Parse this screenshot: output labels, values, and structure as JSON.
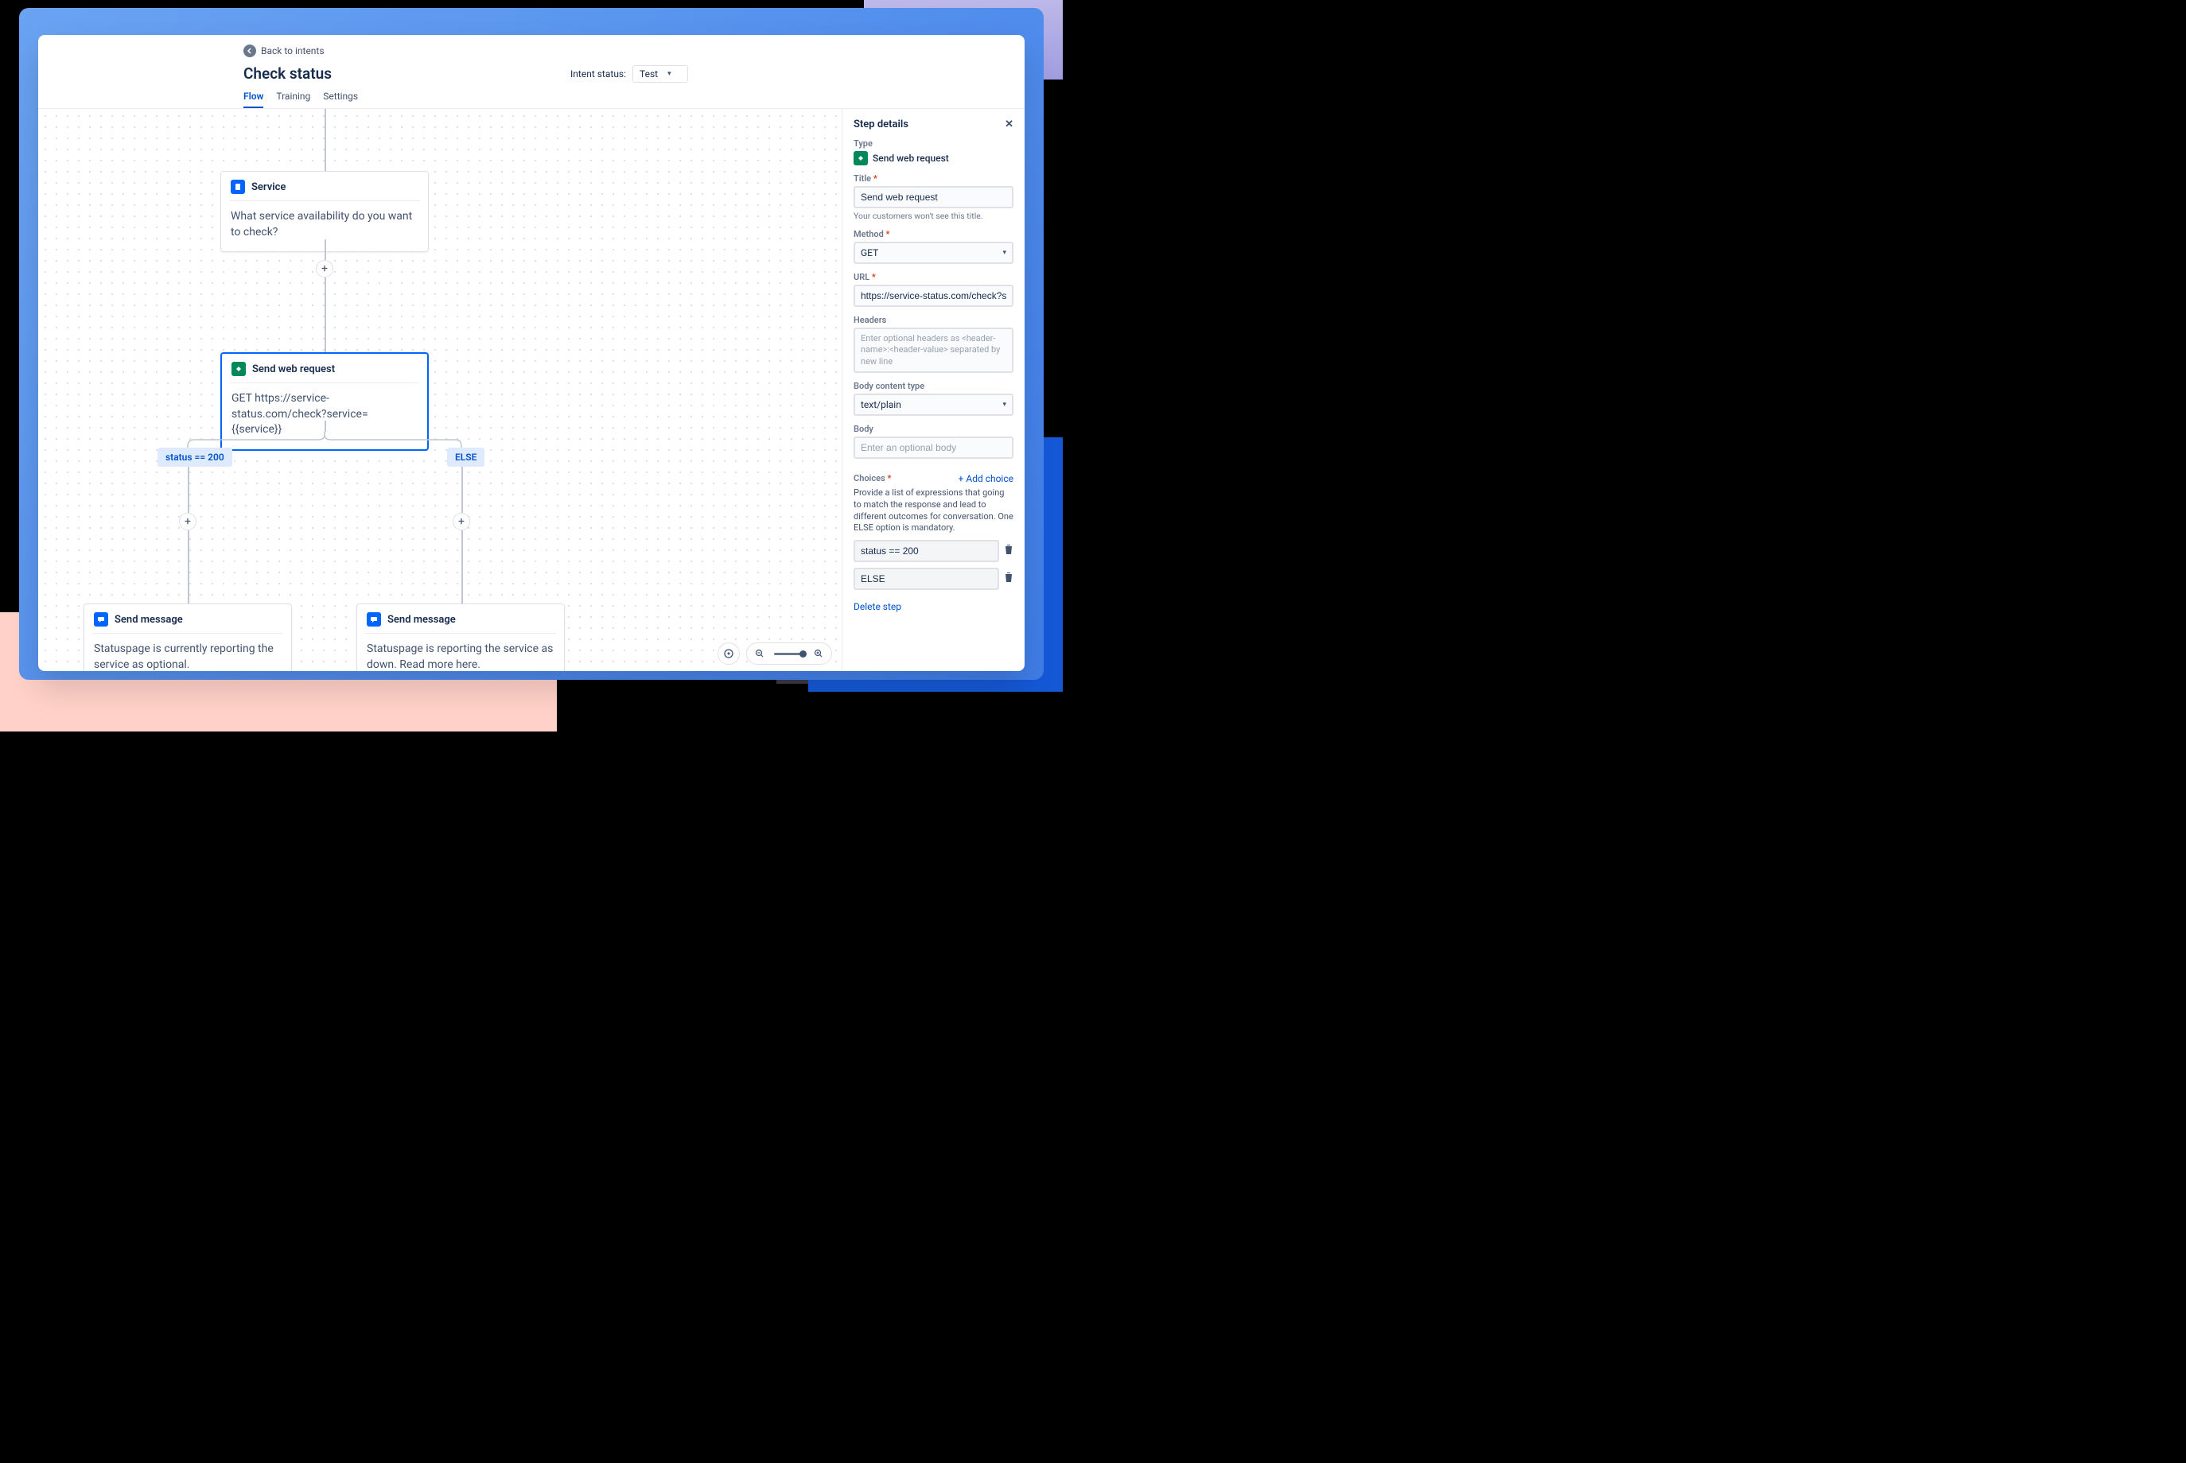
{
  "back_label": "Back to intents",
  "page_title": "Check status",
  "intent_status_label": "Intent status:",
  "intent_status_value": "Test",
  "tabs": {
    "flow": "Flow",
    "training": "Training",
    "settings": "Settings"
  },
  "nodes": {
    "service": {
      "title": "Service",
      "body": "What service availability do you want to check?"
    },
    "webreq": {
      "title": "Send web request",
      "body": "GET https://service-status.com/check?service={{service}}"
    },
    "msg_left": {
      "title": "Send message",
      "body": "Statuspage is currently reporting the service as optional."
    },
    "msg_right": {
      "title": "Send message",
      "body": "Statuspage is reporting the service as down. Read more here."
    }
  },
  "branches": {
    "left": "status == 200",
    "right": "ELSE"
  },
  "sidebar": {
    "heading": "Step details",
    "type_label": "Type",
    "type_value": "Send web request",
    "title_label": "Title",
    "title_value": "Send web request",
    "title_help": "Your customers won't see this title.",
    "method_label": "Method",
    "method_value": "GET",
    "url_label": "URL",
    "url_value": "https://service-status.com/check?service={{service}}",
    "headers_label": "Headers",
    "headers_placeholder": "Enter optional headers as <header-name>:<header-value> separated by new line",
    "bodytype_label": "Body content type",
    "bodytype_value": "text/plain",
    "body_label": "Body",
    "body_placeholder": "Enter an optional body",
    "choices_label": "Choices",
    "add_choice": "Add choice",
    "choices_desc": "Provide a list of expressions that going to match the response and lead to different outcomes for conversation. One ELSE option is mandatory.",
    "choice1": "status == 200",
    "choice2": "ELSE",
    "delete_step": "Delete step"
  }
}
